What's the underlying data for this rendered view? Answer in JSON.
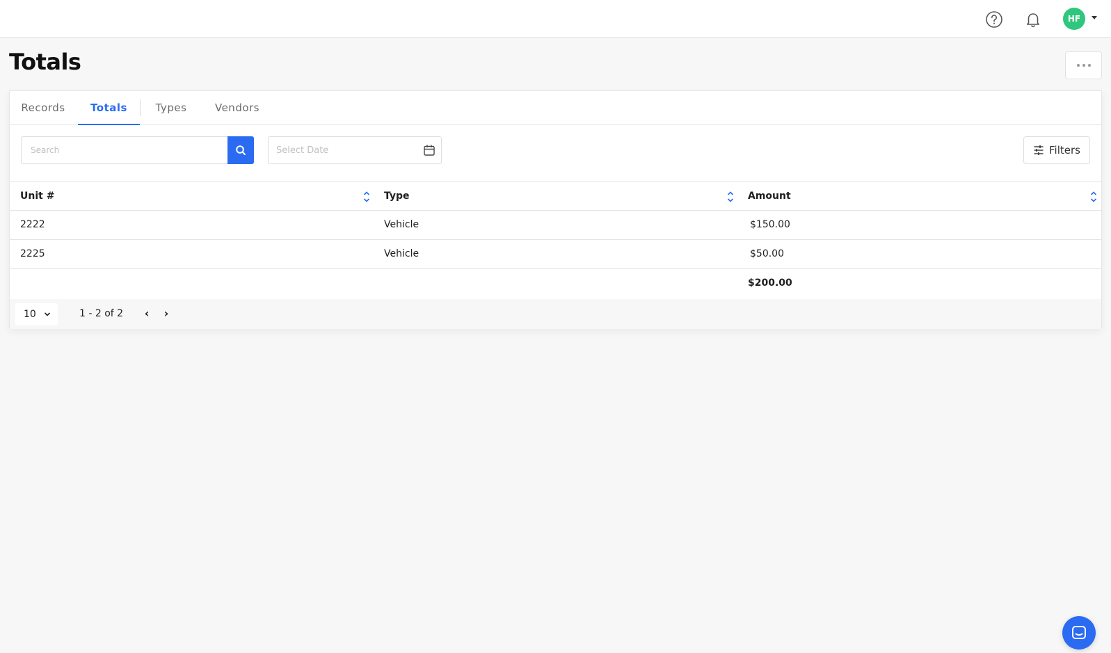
{
  "header": {
    "avatar_initials": "HF",
    "avatar_color": "#2ec77d",
    "icons": [
      "help-circle-icon",
      "bell-icon",
      "caret-down-icon"
    ]
  },
  "page": {
    "title": "Totals",
    "more_icon": "ellipsis-icon"
  },
  "tabs": [
    {
      "label": "Records",
      "active": false
    },
    {
      "label": "Totals",
      "active": true
    },
    {
      "label": "Types",
      "active": false
    },
    {
      "label": "Vendors",
      "active": false
    }
  ],
  "toolbar": {
    "search_placeholder": "Search",
    "search_value": "",
    "date_placeholder": "Select Date",
    "date_value": "",
    "filters_label": "Filters"
  },
  "table": {
    "columns": [
      "Unit #",
      "Type",
      "Amount"
    ],
    "rows": [
      {
        "unit": "2222",
        "type": "Vehicle",
        "amount": "$150.00"
      },
      {
        "unit": "2225",
        "type": "Vehicle",
        "amount": "$50.00"
      }
    ],
    "total": "$200.00"
  },
  "pagination": {
    "page_size": "10",
    "range": "1 - 2 of 2",
    "prev": "‹",
    "next": "›"
  },
  "colors": {
    "accent": "#2a6bf2",
    "avatar": "#2ec77d",
    "background": "#f7f7f7"
  }
}
